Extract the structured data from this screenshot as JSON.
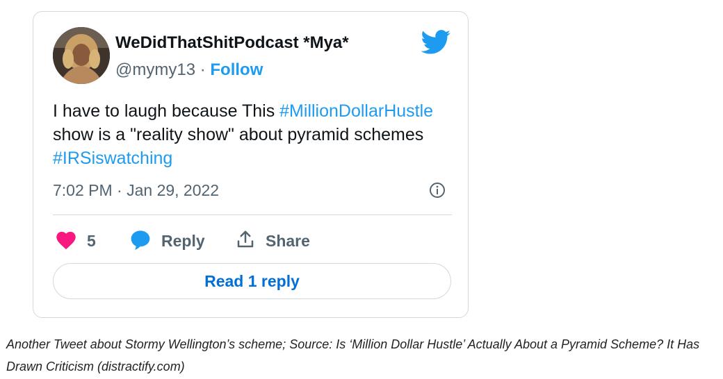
{
  "tweet": {
    "display_name": "WeDidThatShitPodcast *Mya*",
    "handle": "@mymy13",
    "separator": " · ",
    "follow_label": "Follow",
    "text_part1": "I have to laugh because This ",
    "hashtag1": "#MillionDollarHustle",
    "text_part2": " show is a \"reality show\" about pyramid schemes ",
    "hashtag2": "#IRSiswatching",
    "timestamp": "7:02 PM · Jan 29, 2022",
    "like_count": "5",
    "reply_label": "Reply",
    "share_label": "Share",
    "read_replies_label": "Read 1 reply"
  },
  "icons": {
    "brand": "twitter-bird-icon",
    "info": "info-icon",
    "like": "heart-icon",
    "reply": "speech-bubble-icon",
    "share": "share-upload-icon"
  },
  "colors": {
    "accent": "#1d9bf0",
    "like": "#f91880",
    "link_button": "#006fd6",
    "muted": "#536471"
  },
  "caption": "Another Tweet about Stormy Wellington’s scheme; Source: Is ‘Million Dollar Hustle’ Actually About a Pyramid Scheme? It Has Drawn Criticism (distractify.com)"
}
